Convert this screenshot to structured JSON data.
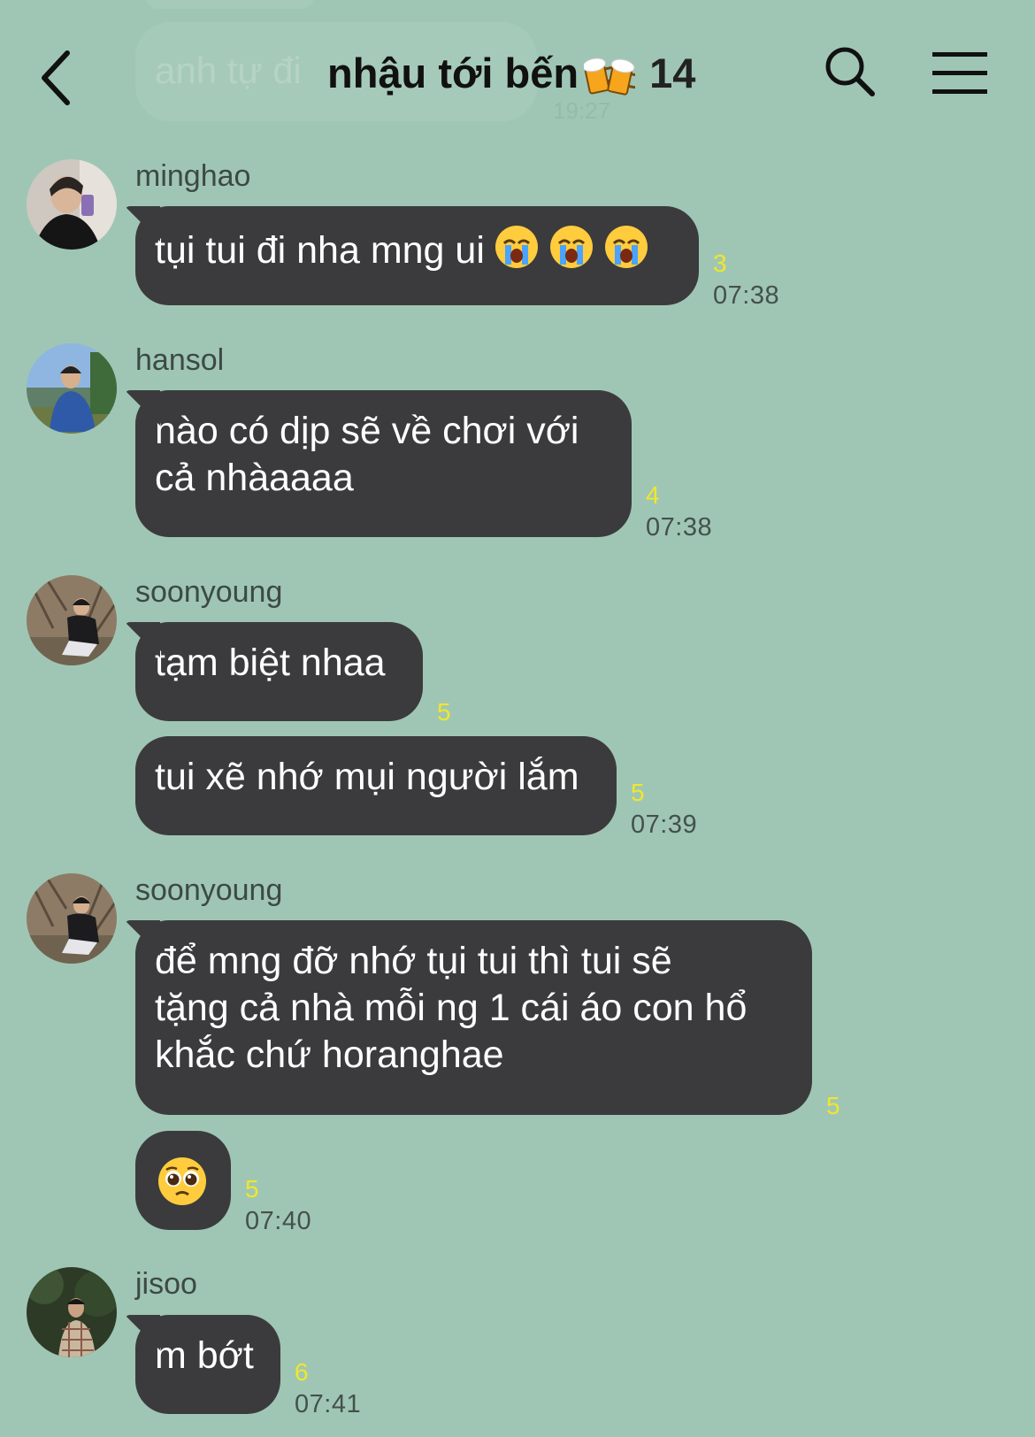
{
  "faded_message": {
    "text": "anh tự đi",
    "time": "19:27"
  },
  "header": {
    "title": "nhậu tới bến",
    "member_count": "14"
  },
  "messages": [
    {
      "sender": "minghao",
      "bubbles": [
        {
          "text": "tụi tui đi nha mng ui",
          "emoji": [
            "crying-face",
            "crying-face",
            "crying-face"
          ],
          "unread": "3"
        }
      ],
      "time": "07:38"
    },
    {
      "sender": "hansol",
      "bubbles": [
        {
          "lines": [
            "nào có dịp sẽ về chơi với",
            "cả nhàaaaa"
          ],
          "unread": "4"
        }
      ],
      "time": "07:38"
    },
    {
      "sender": "soonyoung",
      "bubbles": [
        {
          "text": "tạm biệt nhaa",
          "unread": "5"
        },
        {
          "text": "tui xẽ nhớ mụi người lắm",
          "unread": "5"
        }
      ],
      "time": "07:39"
    },
    {
      "sender": "soonyoung",
      "bubbles": [
        {
          "lines": [
            "để mng đỡ nhớ tụi tui thì tui sẽ",
            "tặng cả nhà mỗi ng 1 cái áo con hổ",
            "khắc chứ horanghae"
          ],
          "unread": "5"
        },
        {
          "emoji": "pleading-face",
          "unread": "5"
        }
      ],
      "time": "07:40"
    },
    {
      "sender": "jisoo",
      "bubbles": [
        {
          "text": "m bớt",
          "unread": "6"
        }
      ],
      "time": "07:41"
    }
  ],
  "colors": {
    "background": "#9fc6b4",
    "bubble": "#3b3b3d",
    "unread": "#f2e62a"
  }
}
